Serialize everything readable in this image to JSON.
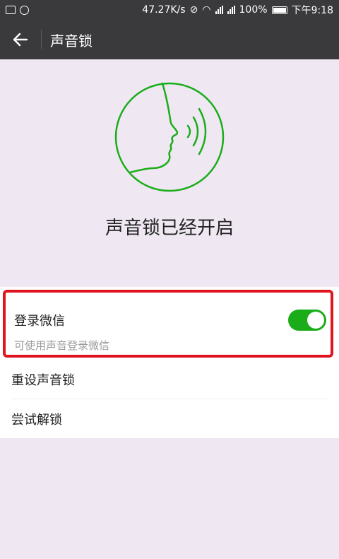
{
  "status_bar": {
    "speed": "47.27K/s",
    "battery": "100%",
    "time": "下午9:18"
  },
  "app_bar": {
    "back_icon": "arrow-left-icon",
    "title": "声音锁"
  },
  "hero": {
    "icon": "voice-face-icon",
    "accent_color": "#1aad19",
    "title": "声音锁已经开启"
  },
  "settings": {
    "login": {
      "label": "登录微信",
      "description": "可使用声音登录微信",
      "enabled": true
    },
    "reset_label": "重设声音锁",
    "try_unlock_label": "尝试解锁"
  },
  "colors": {
    "toggle_on": "#1aad19",
    "highlight_border": "#e0141e",
    "bar": "#3a3a3c"
  }
}
